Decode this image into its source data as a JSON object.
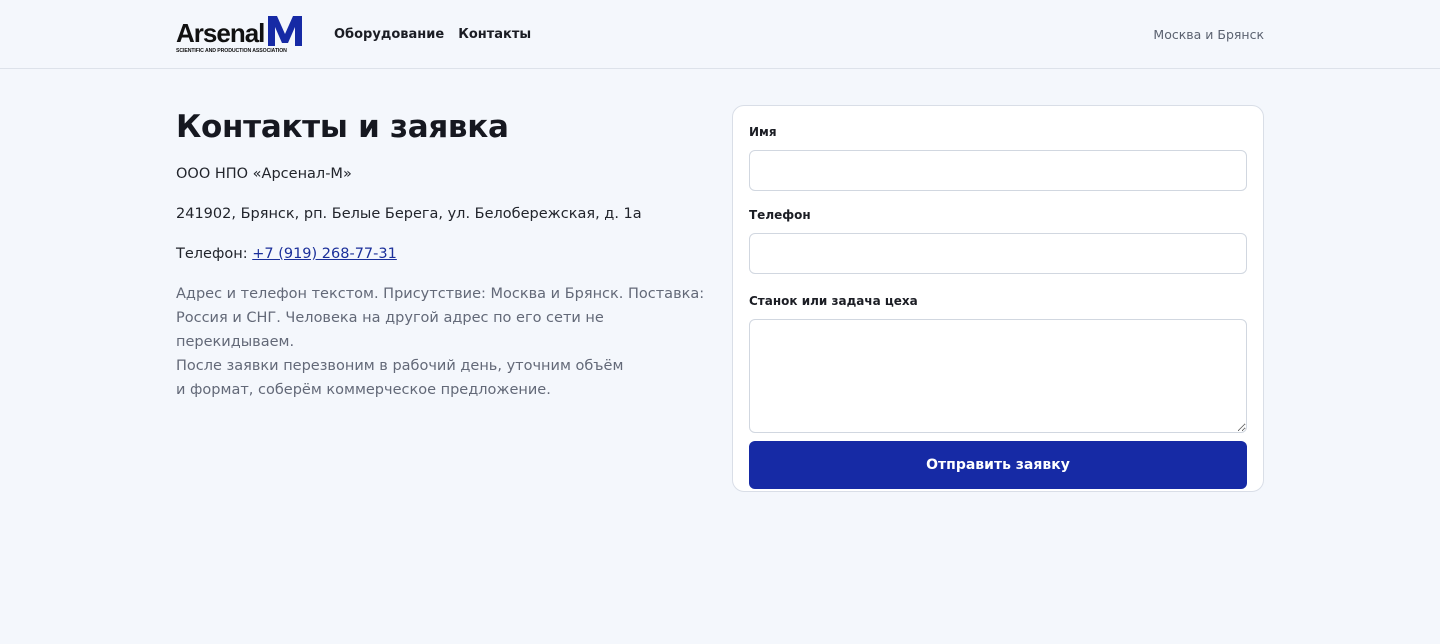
{
  "header": {
    "logo_word": "Arsenal",
    "logo_letter": "M",
    "logo_subtitle": "SCIENTIFIC AND PRODUCTION ASSOCIATION",
    "nav": [
      {
        "label": "Оборудование"
      },
      {
        "label": "Контакты"
      }
    ],
    "region": "Москва и Брянск"
  },
  "contacts": {
    "title": "Контакты и заявка",
    "company": "ООО НПО «Арсенал-М»",
    "address": "241902, Брянск, рп. Белые Берега, ул. Белобережская, д. 1а",
    "phone_label": "Телефон: ",
    "phone": "+7 (919) 268-77-31",
    "note_lines": [
      "Адрес и телефон текстом. Присутствие: Москва и Брянск. Поставка:",
      "Россия и СНГ. Человека на другой адрес по его сети не перекидываем.",
      "После заявки перезвоним в рабочий день, уточним объём",
      "и формат, соберём коммерческое предложение."
    ]
  },
  "form": {
    "name_label": "Имя",
    "name_value": "",
    "phone_label": "Телефон",
    "phone_value": "",
    "task_label": "Станок или задача цеха",
    "task_value": "",
    "submit_label": "Отправить заявку"
  },
  "colors": {
    "brand": "#162aa5",
    "background": "#f4f7fc",
    "link": "#1b2f9a"
  }
}
